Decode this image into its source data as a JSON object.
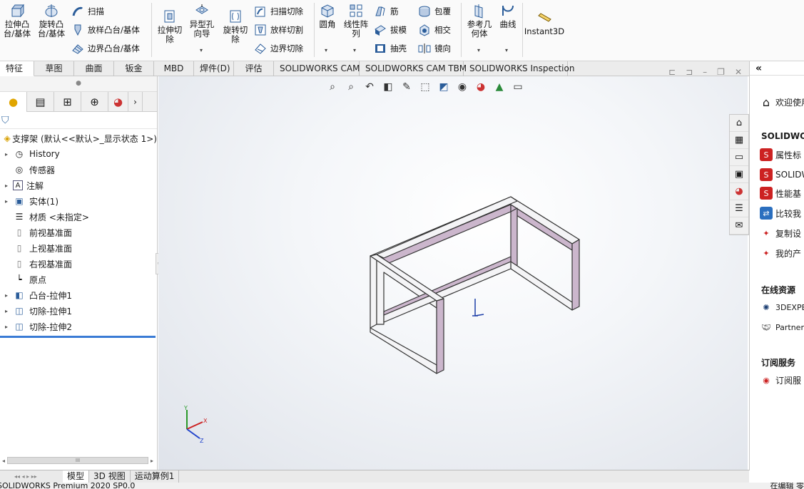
{
  "ribbon": {
    "extrude_boss": "拉伸凸台/基体",
    "revolve_boss": "旋转凸台/基体",
    "sweep": "扫描",
    "loft_boss": "放样凸台/基体",
    "boundary_boss": "边界凸台/基体",
    "extrude_cut": "拉伸切除",
    "hole_wizard": "异型孔向导",
    "revolve_cut": "旋转切除",
    "sweep_cut": "扫描切除",
    "loft_cut": "放样切割",
    "boundary_cut": "边界切除",
    "fillet": "圆角",
    "linear_pattern": "线性阵列",
    "rib": "筋",
    "draft": "拔模",
    "shell": "抽壳",
    "wrap": "包覆",
    "intersect": "相交",
    "mirror": "镜向",
    "ref_geometry": "参考几何体",
    "curves": "曲线",
    "instant3d": "Instant3D"
  },
  "tabs": [
    "特征",
    "草图",
    "曲面",
    "钣金",
    "MBD",
    "焊件(D)",
    "评估",
    "SOLIDWORKS CAM",
    "SOLIDWORKS CAM TBM",
    "SOLIDWORKS Inspection"
  ],
  "tree": {
    "root": "支撑架 (默认<<默认>_显示状态 1>)",
    "items": [
      "History",
      "传感器",
      "注解",
      "实体(1)",
      "材质 <未指定>",
      "前视基准面",
      "上视基准面",
      "右视基准面",
      "原点",
      "凸台-拉伸1",
      "切除-拉伸1",
      "切除-拉伸2"
    ]
  },
  "bottom_tabs": [
    "模型",
    "3D 视图",
    "运动算例1"
  ],
  "status_text": "SOLIDWORKS Premium 2020 SP0.0",
  "status_right": "在编辑 零",
  "right_panel": {
    "welcome": "欢迎使用",
    "section1": "SOLIDWORKS",
    "items1": [
      "属性标",
      "SOLIDW",
      "性能基",
      "比较我",
      "复制设",
      "我的产"
    ],
    "section2": "在线资源",
    "items2": [
      "3DEXPE",
      "Partner"
    ],
    "section3": "订阅服务",
    "items3": [
      "订阅服"
    ]
  },
  "collapse_icon": "«",
  "axis_labels": {
    "x": "X",
    "y": "Y",
    "z": "Z"
  },
  "colors": {
    "frame_outer": "#f4f4f6",
    "frame_inner": "#cbb6cc",
    "accent": "#1e5fa8"
  }
}
